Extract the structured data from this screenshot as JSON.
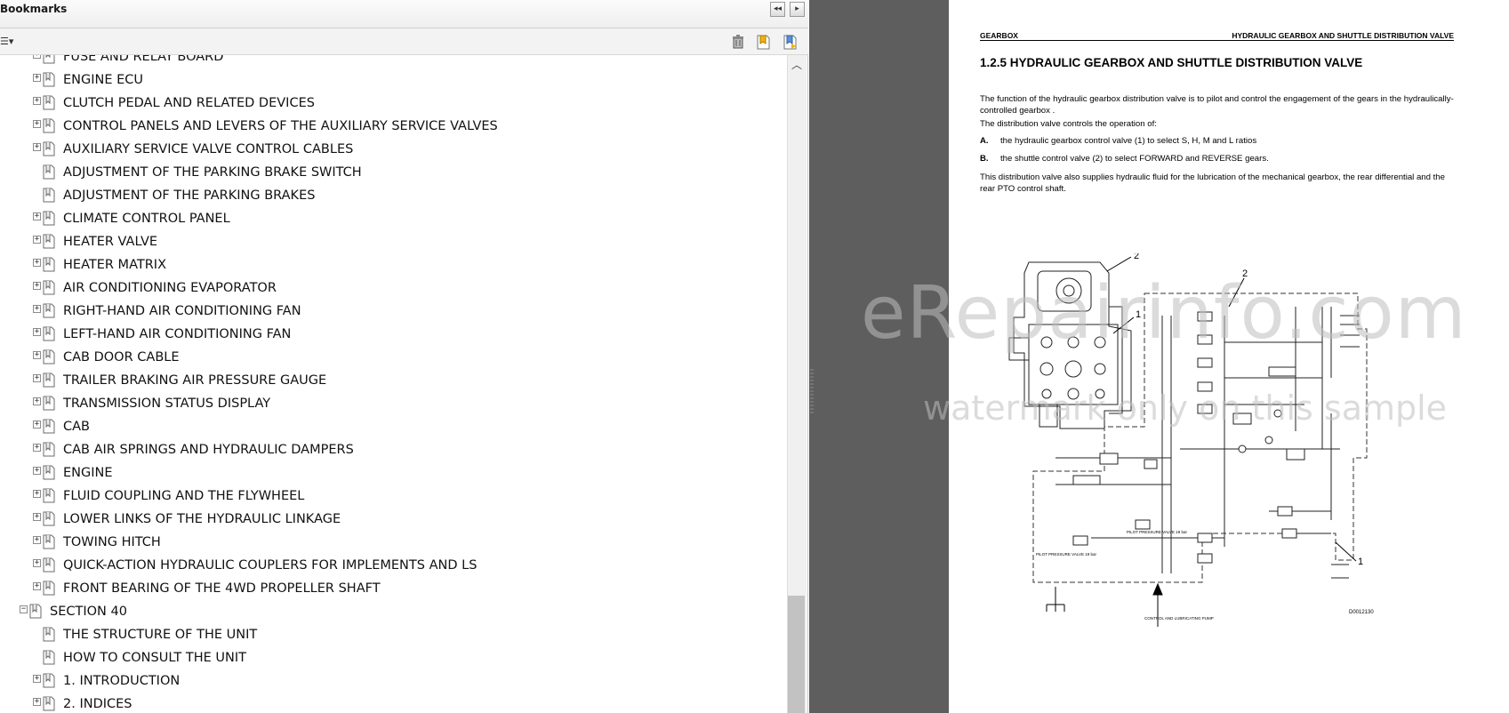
{
  "bookmarks_panel": {
    "title": "Bookmarks",
    "header_buttons": {
      "collapse_icon": "double-left-arrow-icon",
      "close_icon": "right-arrow-icon"
    },
    "toolbar": {
      "options_icon": "bookmark-options-icon",
      "delete_icon": "trash-icon",
      "new_bookmark_icon": "new-bookmark-icon",
      "expand_bookmark_icon": "expand-bookmark-icon"
    },
    "items": [
      {
        "label": "FUSE AND RELAY BOARD",
        "level": 2,
        "expander": "+"
      },
      {
        "label": "ENGINE ECU",
        "level": 2,
        "expander": "+"
      },
      {
        "label": "CLUTCH PEDAL AND RELATED DEVICES",
        "level": 2,
        "expander": "+"
      },
      {
        "label": "CONTROL PANELS AND LEVERS OF THE AUXILIARY SERVICE VALVES",
        "level": 2,
        "expander": "+"
      },
      {
        "label": "AUXILIARY SERVICE VALVE CONTROL CABLES",
        "level": 2,
        "expander": "+"
      },
      {
        "label": "ADJUSTMENT OF THE PARKING BRAKE SWITCH",
        "level": 2,
        "expander": ""
      },
      {
        "label": "ADJUSTMENT OF THE PARKING BRAKES",
        "level": 2,
        "expander": ""
      },
      {
        "label": "CLIMATE CONTROL PANEL",
        "level": 2,
        "expander": "+"
      },
      {
        "label": "HEATER VALVE",
        "level": 2,
        "expander": "+"
      },
      {
        "label": "HEATER MATRIX",
        "level": 2,
        "expander": "+"
      },
      {
        "label": "AIR CONDITIONING EVAPORATOR",
        "level": 2,
        "expander": "+"
      },
      {
        "label": "RIGHT-HAND AIR CONDITIONING FAN",
        "level": 2,
        "expander": "+"
      },
      {
        "label": "LEFT-HAND AIR CONDITIONING FAN",
        "level": 2,
        "expander": "+"
      },
      {
        "label": "CAB DOOR CABLE",
        "level": 2,
        "expander": "+"
      },
      {
        "label": "TRAILER BRAKING AIR PRESSURE GAUGE",
        "level": 2,
        "expander": "+"
      },
      {
        "label": "TRANSMISSION STATUS DISPLAY",
        "level": 2,
        "expander": "+"
      },
      {
        "label": "CAB",
        "level": 2,
        "expander": "+"
      },
      {
        "label": "CAB AIR SPRINGS AND HYDRAULIC DAMPERS",
        "level": 2,
        "expander": "+"
      },
      {
        "label": "ENGINE",
        "level": 2,
        "expander": "+"
      },
      {
        "label": "FLUID COUPLING AND THE FLYWHEEL",
        "level": 2,
        "expander": "+"
      },
      {
        "label": "LOWER LINKS OF THE HYDRAULIC LINKAGE",
        "level": 2,
        "expander": "+"
      },
      {
        "label": "TOWING HITCH",
        "level": 2,
        "expander": "+"
      },
      {
        "label": "QUICK-ACTION HYDRAULIC COUPLERS FOR IMPLEMENTS AND LS",
        "level": 2,
        "expander": "+"
      },
      {
        "label": "FRONT BEARING OF THE 4WD PROPELLER SHAFT",
        "level": 2,
        "expander": "+"
      },
      {
        "label": "SECTION 40",
        "level": 1,
        "expander": "−"
      },
      {
        "label": "THE STRUCTURE OF THE UNIT",
        "level": 2,
        "expander": ""
      },
      {
        "label": "HOW TO CONSULT THE UNIT",
        "level": 2,
        "expander": ""
      },
      {
        "label": "1. INTRODUCTION",
        "level": 2,
        "expander": "+"
      },
      {
        "label": "2. INDICES",
        "level": 2,
        "expander": "+"
      }
    ]
  },
  "document": {
    "header_left": "GEARBOX",
    "header_right": "HYDRAULIC GEARBOX AND SHUTTLE DISTRIBUTION VALVE",
    "heading": "1.2.5 HYDRAULIC GEARBOX AND SHUTTLE DISTRIBUTION VALVE",
    "para1": "The function of the hydraulic gearbox distribution valve is to pilot and control the engagement of the gears in the hydraulically-controlled gearbox .",
    "para2": "The distribution valve controls the operation of:",
    "item_a_label": "A.",
    "item_a_text": "the hydraulic gearbox control valve (1) to select S, H, M and L ratios",
    "item_b_label": "B.",
    "item_b_text": "the shuttle control valve (2) to select FORWARD and REVERSE gears.",
    "para3": "This distribution valve also supplies hydraulic fluid for the lubrication of the mechanical gearbox, the rear differential and the rear PTO control shaft.",
    "diagram": {
      "callout_2a": "2",
      "callout_2b": "2",
      "callout_1a": "1",
      "callout_1b": "1",
      "pump_label": "CONTROL AND LUBRICATING PUMP",
      "pilot_label_1": "PILOT PRESSURE VALVE 19 bar",
      "pilot_label_2": "PILOT PRESSURE VALVE 19 bar",
      "figure_code": "D0012130"
    }
  },
  "watermark": {
    "line1": "eRepairinfo.com",
    "line2": "watermark only on this sample"
  },
  "colors": {
    "viewer_background": "#5e5e5e",
    "panel_background": "#ffffff",
    "watermark": "#bebebe"
  }
}
